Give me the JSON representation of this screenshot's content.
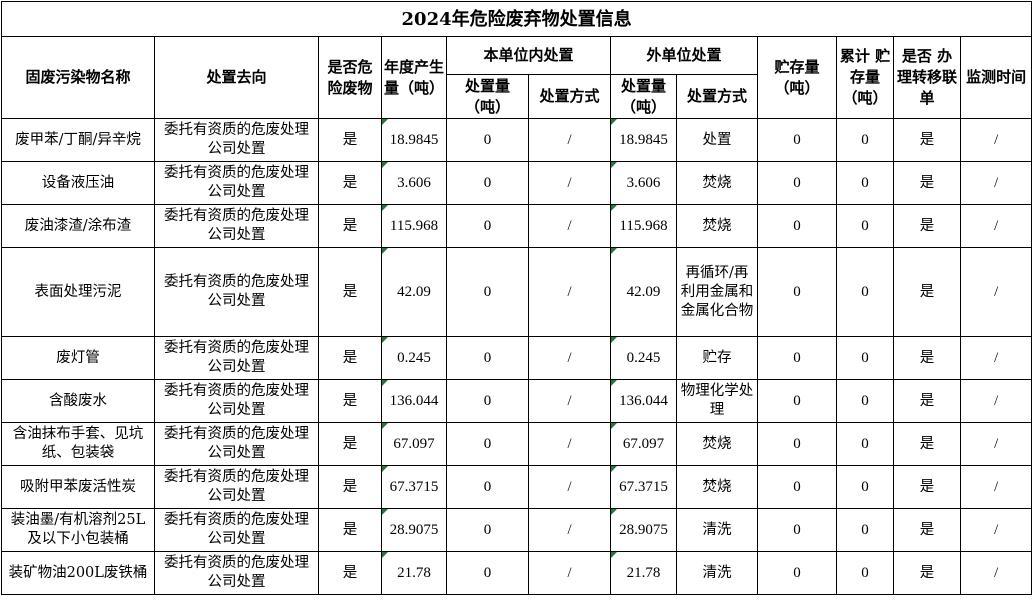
{
  "title": "2024年危险废弃物处置信息",
  "headers": {
    "name": "固废污染物名称",
    "destination": "处置去向",
    "is_hazardous": "是否危险废物",
    "annual_output": "年度产生量（吨）",
    "internal_group": "本单位内处置",
    "internal_amount": "处置量（吨）",
    "internal_method": "处置方式",
    "external_group": "外单位处置",
    "external_amount": "处置量（吨）",
    "external_method": "处置方式",
    "storage": "贮存量（吨）",
    "cumulative_storage": "累计 贮存量（吨）",
    "transfer_form": "是否 办理转移联单",
    "monitor_time": "监测时间"
  },
  "rows": [
    {
      "name": "废甲苯/丁酮/异辛烷",
      "destination": "委托有资质的危废处理公司处置",
      "is_hazardous": "是",
      "annual_output": "18.9845",
      "internal_amount": "0",
      "internal_method": "/",
      "external_amount": "18.9845",
      "external_method": "处置",
      "storage": "0",
      "cumulative_storage": "0",
      "transfer_form": "是",
      "monitor_time": "/"
    },
    {
      "name": "设备液压油",
      "destination": "委托有资质的危废处理公司处置",
      "is_hazardous": "是",
      "annual_output": "3.606",
      "internal_amount": "0",
      "internal_method": "/",
      "external_amount": "3.606",
      "external_method": "焚烧",
      "storage": "0",
      "cumulative_storage": "0",
      "transfer_form": "是",
      "monitor_time": "/"
    },
    {
      "name": "废油漆渣/涂布渣",
      "destination": "委托有资质的危废处理公司处置",
      "is_hazardous": "是",
      "annual_output": "115.968",
      "internal_amount": "0",
      "internal_method": "/",
      "external_amount": "115.968",
      "external_method": "焚烧",
      "storage": "0",
      "cumulative_storage": "0",
      "transfer_form": "是",
      "monitor_time": "/"
    },
    {
      "name": "表面处理污泥",
      "destination": "委托有资质的危废处理公司处置",
      "is_hazardous": "是",
      "annual_output": "42.09",
      "internal_amount": "0",
      "internal_method": "/",
      "external_amount": "42.09",
      "external_method": "再循环/再利用金属和金属化合物",
      "storage": "0",
      "cumulative_storage": "0",
      "transfer_form": "是",
      "monitor_time": "/"
    },
    {
      "name": "废灯管",
      "destination": "委托有资质的危废处理公司处置",
      "is_hazardous": "是",
      "annual_output": "0.245",
      "internal_amount": "0",
      "internal_method": "/",
      "external_amount": "0.245",
      "external_method": "贮存",
      "storage": "0",
      "cumulative_storage": "0",
      "transfer_form": "是",
      "monitor_time": "/"
    },
    {
      "name": "含酸废水",
      "destination": "委托有资质的危废处理公司处置",
      "is_hazardous": "是",
      "annual_output": "136.044",
      "internal_amount": "0",
      "internal_method": "/",
      "external_amount": "136.044",
      "external_method": "物理化学处理",
      "storage": "0",
      "cumulative_storage": "0",
      "transfer_form": "是",
      "monitor_time": "/"
    },
    {
      "name": "含油抹布手套、见坑纸、包装袋",
      "destination": "委托有资质的危废处理公司处置",
      "is_hazardous": "是",
      "annual_output": "67.097",
      "internal_amount": "0",
      "internal_method": "/",
      "external_amount": "67.097",
      "external_method": "焚烧",
      "storage": "0",
      "cumulative_storage": "0",
      "transfer_form": "是",
      "monitor_time": "/"
    },
    {
      "name": "吸附甲苯废活性炭",
      "destination": "委托有资质的危废处理公司处置",
      "is_hazardous": "是",
      "annual_output": "67.3715",
      "internal_amount": "0",
      "internal_method": "/",
      "external_amount": "67.3715",
      "external_method": "焚烧",
      "storage": "0",
      "cumulative_storage": "0",
      "transfer_form": "是",
      "monitor_time": "/"
    },
    {
      "name": "装油墨/有机溶剂25L及以下小包装桶",
      "destination": "委托有资质的危废处理公司处置",
      "is_hazardous": "是",
      "annual_output": "28.9075",
      "internal_amount": "0",
      "internal_method": "/",
      "external_amount": "28.9075",
      "external_method": "清洗",
      "storage": "0",
      "cumulative_storage": "0",
      "transfer_form": "是",
      "monitor_time": "/"
    },
    {
      "name": "装矿物油200L废铁桶",
      "destination": "委托有资质的危废处理公司处置",
      "is_hazardous": "是",
      "annual_output": "21.78",
      "internal_amount": "0",
      "internal_method": "/",
      "external_amount": "21.78",
      "external_method": "清洗",
      "storage": "0",
      "cumulative_storage": "0",
      "transfer_form": "是",
      "monitor_time": "/"
    }
  ]
}
